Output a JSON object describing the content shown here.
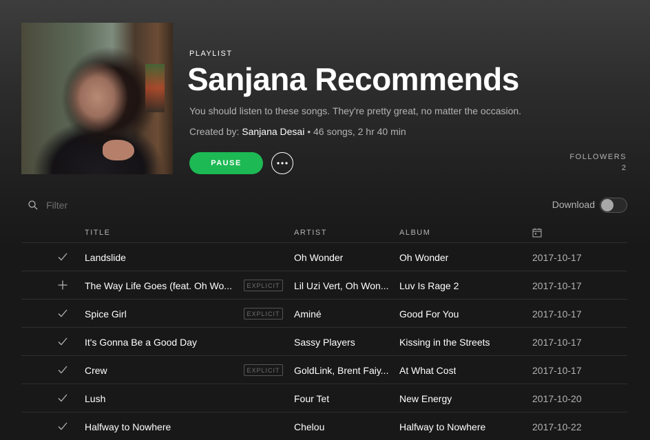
{
  "header": {
    "type_label": "PLAYLIST",
    "title": "Sanjana Recommends",
    "description": "You should listen to these songs. They're pretty great, no matter the occasion.",
    "created_by_label": "Created by:",
    "owner": "Sanjana Desai",
    "stats": " • 46 songs, 2 hr 40 min",
    "pause_label": "PAUSE",
    "followers_label": "FOLLOWERS",
    "followers_count": "2"
  },
  "controls": {
    "filter_placeholder": "Filter",
    "download_label": "Download",
    "download_enabled": false
  },
  "table": {
    "columns": {
      "title": "TITLE",
      "artist": "ARTIST",
      "album": "ALBUM"
    },
    "explicit_label": "EXPLICIT",
    "rows": [
      {
        "status": "saved",
        "title": "Landslide",
        "explicit": false,
        "artist": "Oh Wonder",
        "album": "Oh Wonder",
        "date": "2017-10-17"
      },
      {
        "status": "add",
        "title": "The Way Life Goes (feat. Oh Wo...",
        "explicit": true,
        "artist": "Lil Uzi Vert, Oh Won...",
        "album": "Luv Is Rage 2",
        "date": "2017-10-17"
      },
      {
        "status": "saved",
        "title": "Spice Girl",
        "explicit": true,
        "artist": "Aminé",
        "album": "Good For You",
        "date": "2017-10-17"
      },
      {
        "status": "saved",
        "title": "It's Gonna Be a Good Day",
        "explicit": false,
        "artist": "Sassy Players",
        "album": "Kissing in the Streets",
        "date": "2017-10-17"
      },
      {
        "status": "saved",
        "title": "Crew",
        "explicit": true,
        "artist": "GoldLink, Brent Faiy...",
        "album": "At What Cost",
        "date": "2017-10-17"
      },
      {
        "status": "saved",
        "title": "Lush",
        "explicit": false,
        "artist": "Four Tet",
        "album": "New Energy",
        "date": "2017-10-20"
      },
      {
        "status": "saved",
        "title": "Halfway to Nowhere",
        "explicit": false,
        "artist": "Chelou",
        "album": "Halfway to Nowhere",
        "date": "2017-10-22"
      }
    ]
  },
  "colors": {
    "accent": "#1db954",
    "background": "#181818",
    "muted_text": "#b3b3b3"
  },
  "icons": {
    "filter": "search-icon",
    "more": "more-options-icon",
    "date_column": "calendar-icon",
    "saved": "check-icon",
    "add": "plus-icon"
  }
}
